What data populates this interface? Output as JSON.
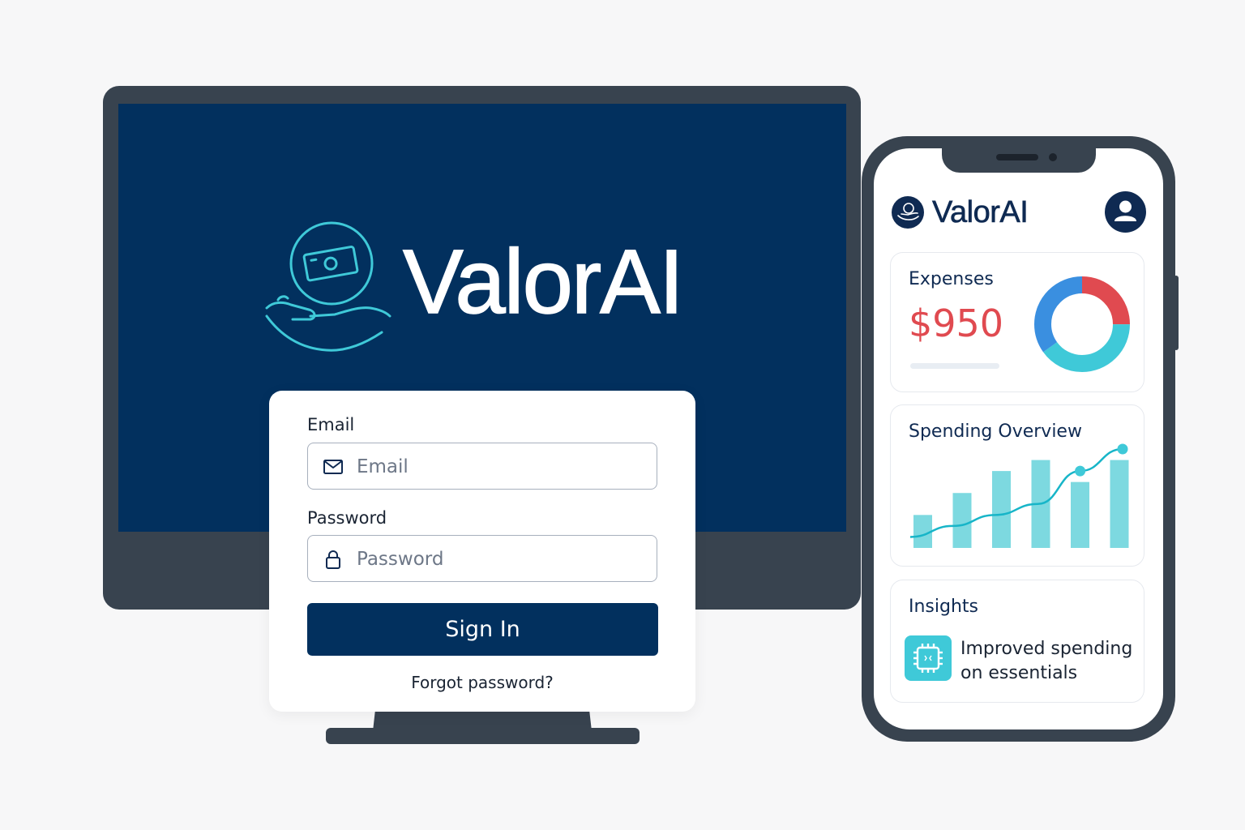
{
  "desktop": {
    "brand": "ValorAI",
    "login": {
      "email_label": "Email",
      "email_placeholder": "Email",
      "password_label": "Password",
      "password_placeholder": "Password",
      "signin_label": "Sign In",
      "forgot_label": "Forgot password?"
    }
  },
  "mobile": {
    "app_name": "ValorAI",
    "expenses": {
      "title": "Expenses",
      "amount": "$950",
      "donut_segments": [
        {
          "color": "#e04a50",
          "fraction": 0.25
        },
        {
          "color": "#3fc9d8",
          "fraction": 0.4
        },
        {
          "color": "#3a8fe0",
          "fraction": 0.35
        }
      ]
    },
    "spending_overview": {
      "title": "Spending Overview",
      "chart_data": {
        "type": "bar",
        "bar_values": [
          3,
          5,
          7,
          8,
          6,
          8
        ],
        "line_values": [
          1,
          2,
          3,
          4,
          7,
          9
        ]
      }
    },
    "insights": {
      "title": "Insights",
      "text": "Improved spending on essentials"
    }
  },
  "colors": {
    "navy": "#02305e",
    "device_frame": "#38434f",
    "accent_teal": "#3fc9d8",
    "expense_red": "#e04a50"
  }
}
